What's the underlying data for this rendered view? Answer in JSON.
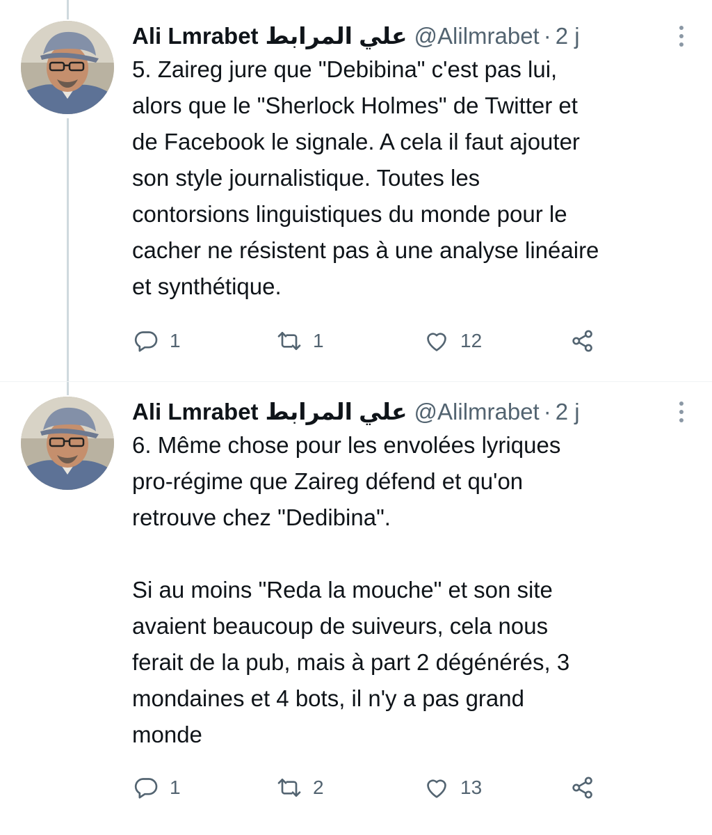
{
  "tweets": [
    {
      "author": {
        "name": "Ali Lmrabet",
        "name_arabic": "علي المرابط",
        "handle": "@Alilmrabet",
        "separator": "·",
        "time": "2 j"
      },
      "text": "5. Zaireg jure que \"Debibina\" c'est pas lui,\nalors que le \"Sherlock Holmes\" de Twitter et\nde Facebook le signale. A cela il faut ajouter\nson style journalistique. Toutes les\ncontorsions linguistiques du monde pour le\ncacher ne résistent pas à une analyse linéaire\net synthétique.",
      "replies": "1",
      "retweets": "1",
      "likes": "12"
    },
    {
      "author": {
        "name": "Ali Lmrabet",
        "name_arabic": "علي المرابط",
        "handle": "@Alilmrabet",
        "separator": "·",
        "time": "2 j"
      },
      "text": "6. Même chose pour les envolées lyriques\npro-régime que Zaireg défend et qu'on\nretrouve chez \"Dedibina\".\n\nSi au moins \"Reda la mouche\" et son site\navaient beaucoup de suiveurs, cela nous\nferait de la pub, mais à part 2 dégénérés, 3\nmondaines et 4 bots, il n'y a pas grand\nmonde",
      "replies": "1",
      "retweets": "2",
      "likes": "13"
    }
  ],
  "icons": {
    "reply": "reply-icon",
    "retweet": "retweet-icon",
    "like": "heart-icon",
    "share": "share-icon",
    "more": "more-options-icon"
  },
  "colors": {
    "text": "#0f1419",
    "secondary": "#536471",
    "thread_line": "#cfd9de"
  }
}
